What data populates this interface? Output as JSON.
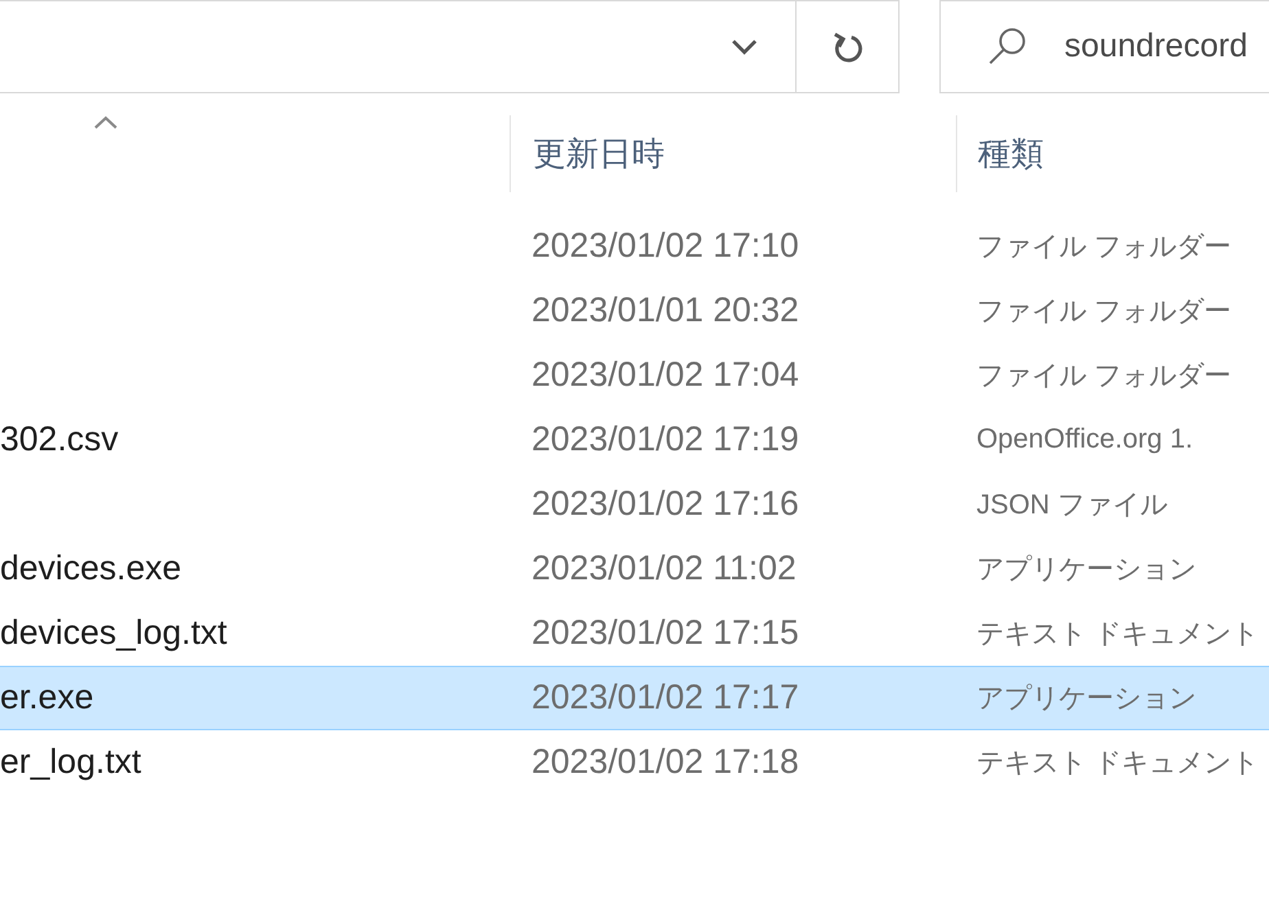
{
  "search": {
    "value": "soundrecord"
  },
  "columns": [
    {
      "sorted": true
    },
    {
      "label": "更新日時",
      "sorted": false
    },
    {
      "label": "種類",
      "sorted": false
    }
  ],
  "rows": [
    {
      "modified": "2023/01/02 17:10",
      "type": "ファイル フォルダー",
      "selected": false
    },
    {
      "modified": "2023/01/01 20:32",
      "type": "ファイル フォルダー",
      "selected": false
    },
    {
      "modified": "2023/01/02 17:04",
      "type": "ファイル フォルダー",
      "selected": false
    },
    {
      "name": "302.csv",
      "modified": "2023/01/02 17:19",
      "type": "OpenOffice.org 1.",
      "selected": false
    },
    {
      "modified": "2023/01/02 17:16",
      "type": "JSON ファイル",
      "selected": false
    },
    {
      "name": "devices.exe",
      "modified": "2023/01/02 11:02",
      "type": "アプリケーション",
      "selected": false
    },
    {
      "name": "devices_log.txt",
      "modified": "2023/01/02 17:15",
      "type": "テキスト ドキュメント",
      "selected": false
    },
    {
      "name": "er.exe",
      "modified": "2023/01/02 17:17",
      "type": "アプリケーション",
      "selected": true
    },
    {
      "name": "er_log.txt",
      "modified": "2023/01/02 17:18",
      "type": "テキスト ドキュメント",
      "selected": false
    }
  ]
}
